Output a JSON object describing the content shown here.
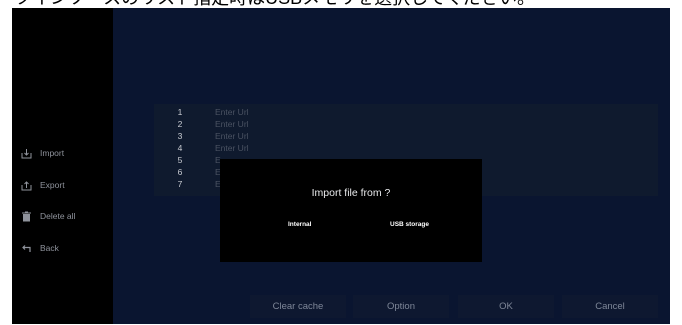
{
  "caption": "ツインソースのリスト指定時はUSBメモリを選択してください。",
  "sidebar": {
    "items": [
      {
        "label": "Import",
        "icon": "import-icon"
      },
      {
        "label": "Export",
        "icon": "export-icon"
      },
      {
        "label": "Delete all",
        "icon": "trash-icon"
      },
      {
        "label": "Back",
        "icon": "back-icon"
      }
    ]
  },
  "url_list": {
    "rows": [
      {
        "num": "1",
        "text": "Enter Url"
      },
      {
        "num": "2",
        "text": "Enter Url"
      },
      {
        "num": "3",
        "text": "Enter Url"
      },
      {
        "num": "4",
        "text": "Enter Url"
      },
      {
        "num": "5",
        "text": "E"
      },
      {
        "num": "6",
        "text": "E"
      },
      {
        "num": "7",
        "text": "E"
      }
    ]
  },
  "dialog": {
    "title": "Import file from ?",
    "internal_label": "Internal",
    "usb_label": "USB storage"
  },
  "bottom_bar": {
    "clear_cache_label": "Clear cache",
    "option_label": "Option",
    "ok_label": "OK",
    "cancel_label": "Cancel"
  },
  "colors": {
    "screen_bg": "#0a1530",
    "sidebar_bg": "#000000",
    "panel_bg": "#0f1a2e",
    "dialog_bg": "#000000",
    "text_muted": "#8f939c"
  }
}
